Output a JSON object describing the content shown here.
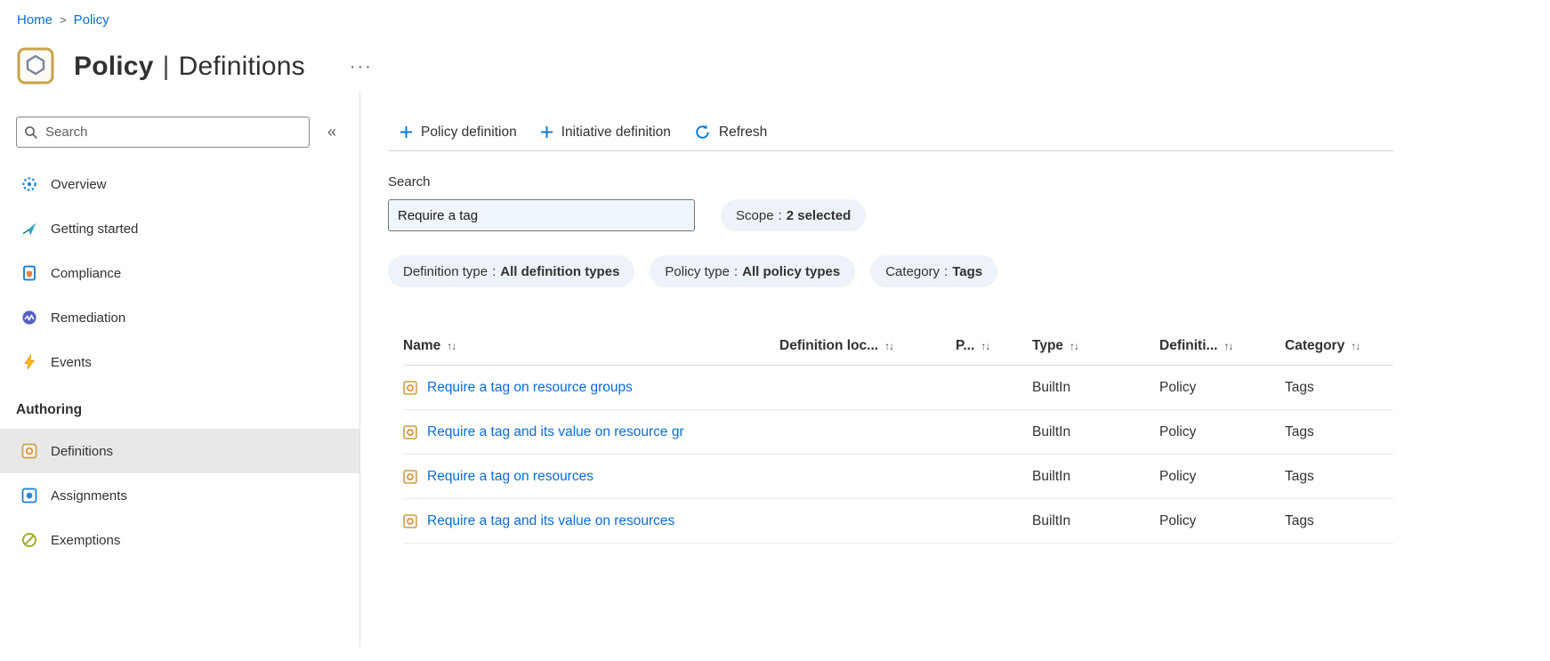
{
  "colors": {
    "accent": "#0078d4",
    "link": "#0b6cd4",
    "pill_bg": "#eef3f9",
    "selected_bg": "#e8e8e8"
  },
  "breadcrumb": {
    "home": "Home",
    "chevron": ">",
    "current": "Policy"
  },
  "header": {
    "title": "Policy",
    "separator": "|",
    "subtitle": "Definitions",
    "more_glyph": "···"
  },
  "sidebar": {
    "search_placeholder": "Search",
    "collapse_glyph": "«",
    "items": [
      {
        "label": "Overview",
        "icon": "overview-icon"
      },
      {
        "label": "Getting started",
        "icon": "getting-started-icon"
      },
      {
        "label": "Compliance",
        "icon": "compliance-icon"
      },
      {
        "label": "Remediation",
        "icon": "remediation-icon"
      },
      {
        "label": "Events",
        "icon": "events-icon"
      }
    ],
    "section_header": "Authoring",
    "authoring_items": [
      {
        "label": "Definitions",
        "icon": "definitions-icon",
        "selected": true
      },
      {
        "label": "Assignments",
        "icon": "assignments-icon",
        "selected": false
      },
      {
        "label": "Exemptions",
        "icon": "exemptions-icon",
        "selected": false
      }
    ]
  },
  "toolbar": {
    "policy_definition": "Policy definition",
    "initiative_definition": "Initiative definition",
    "refresh": "Refresh"
  },
  "filters": {
    "search_label": "Search",
    "search_value": "Require a tag",
    "separator": ":",
    "pills": [
      {
        "label": "Scope",
        "value": "2 selected"
      },
      {
        "label": "Definition type",
        "value": "All definition types"
      },
      {
        "label": "Policy type",
        "value": "All policy types"
      },
      {
        "label": "Category",
        "value": "Tags"
      }
    ]
  },
  "table": {
    "sort_glyph": "↑↓",
    "columns": [
      "Name",
      "Definition loc...",
      "P...",
      "Type",
      "Definiti...",
      "Category"
    ],
    "rows": [
      {
        "name": "Require a tag on resource groups",
        "definition_location": "",
        "p": "",
        "type": "BuiltIn",
        "definition_type": "Policy",
        "category": "Tags"
      },
      {
        "name": "Require a tag and its value on resource gr",
        "definition_location": "",
        "p": "",
        "type": "BuiltIn",
        "definition_type": "Policy",
        "category": "Tags"
      },
      {
        "name": "Require a tag on resources",
        "definition_location": "",
        "p": "",
        "type": "BuiltIn",
        "definition_type": "Policy",
        "category": "Tags"
      },
      {
        "name": "Require a tag and its value on resources",
        "definition_location": "",
        "p": "",
        "type": "BuiltIn",
        "definition_type": "Policy",
        "category": "Tags"
      }
    ]
  }
}
